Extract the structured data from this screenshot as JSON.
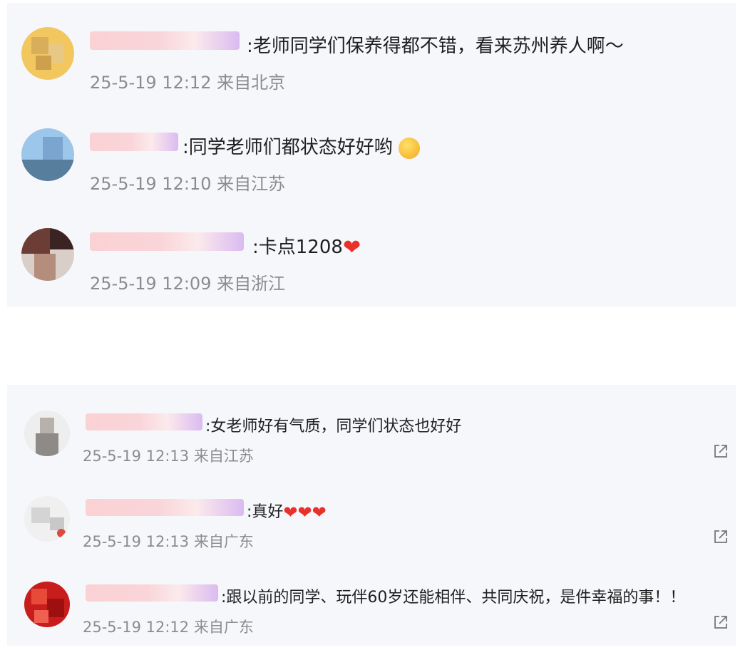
{
  "top_comments": [
    {
      "text": ":老师同学们保养得都不错，看来苏州养人啊～",
      "meta": "25-5-19 12:12 来自北京"
    },
    {
      "text": ":同学老师们都状态好好哟",
      "meta": "25-5-19 12:10 来自江苏"
    },
    {
      "text": ":卡点1208",
      "meta": "25-5-19 12:09 来自浙江"
    }
  ],
  "bottom_comments": [
    {
      "text": ":女老师好有气质，同学们状态也好好",
      "meta": "25-5-19 12:13 来自江苏"
    },
    {
      "text": ":真好",
      "meta": "25-5-19 12:13 来自广东"
    },
    {
      "text": ":跟以前的同学、玩伴60岁还能相伴、共同庆祝，是件幸福的事！！",
      "meta": "25-5-19 12:12 来自广东"
    }
  ],
  "colors": {
    "heart": "#e8312b",
    "meta": "#8c8c8c",
    "panel": "#f6f7fb"
  },
  "icons": [
    "share-icon",
    "heart-icon",
    "blush-emoji-icon"
  ]
}
